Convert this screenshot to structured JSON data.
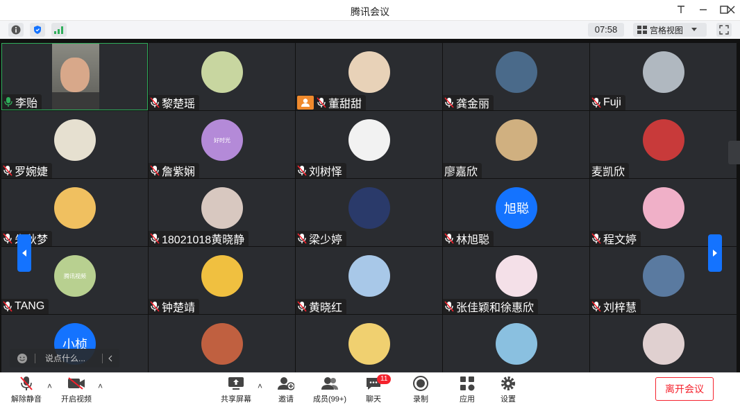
{
  "window": {
    "title": "腾讯会议"
  },
  "infobar": {
    "timer": "07:58",
    "view_label": "宫格视图"
  },
  "participants": [
    {
      "name": "李贻",
      "mic": "on",
      "video": true,
      "active": true
    },
    {
      "name": "黎楚瑶",
      "mic": "muted",
      "avatar": "avatar-1"
    },
    {
      "name": "董甜甜",
      "mic": "muted",
      "host": true,
      "avatar": "avatar-2"
    },
    {
      "name": "龚金丽",
      "mic": "muted",
      "avatar": "avatar-3"
    },
    {
      "name": "Fuji",
      "mic": "muted",
      "avatar": "avatar-4"
    },
    {
      "name": "罗婉婕",
      "mic": "muted",
      "avatar": "avatar-5"
    },
    {
      "name": "詹紫娴",
      "mic": "muted",
      "avatar": "avatar-6",
      "avatar_caption": "好时光"
    },
    {
      "name": "刘树怿",
      "mic": "muted",
      "avatar": "avatar-7"
    },
    {
      "name": "廖嘉欣",
      "mic": "none",
      "avatar": "avatar-8"
    },
    {
      "name": "麦凯欣",
      "mic": "none",
      "avatar": "avatar-9"
    },
    {
      "name": "朱秋梦",
      "mic": "muted",
      "avatar": "avatar-10"
    },
    {
      "name": "18021018黄晓静",
      "mic": "muted",
      "avatar": "avatar-11"
    },
    {
      "name": "梁少婷",
      "mic": "muted",
      "avatar": "avatar-12"
    },
    {
      "name": "林旭聪",
      "mic": "muted",
      "avatar_text": "旭聪"
    },
    {
      "name": "程文婷",
      "mic": "muted",
      "avatar": "avatar-14"
    },
    {
      "name": "TANG",
      "mic": "muted",
      "avatar": "avatar-15",
      "avatar_caption": "腾讯视频"
    },
    {
      "name": "钟楚靖",
      "mic": "muted",
      "avatar": "avatar-16"
    },
    {
      "name": "黄晓红",
      "mic": "muted",
      "avatar": "avatar-17"
    },
    {
      "name": "张佳颖和徐惠欣",
      "mic": "muted",
      "avatar": "avatar-18"
    },
    {
      "name": "刘梓慧",
      "mic": "muted",
      "avatar": "avatar-19"
    },
    {
      "name": "",
      "mic": "muted",
      "avatar_text": "小桢"
    },
    {
      "name": "",
      "mic": "muted",
      "avatar": "avatar-21"
    },
    {
      "name": "",
      "mic": "muted",
      "avatar": "avatar-22"
    },
    {
      "name": "",
      "mic": "muted",
      "avatar": "avatar-23"
    },
    {
      "name": "",
      "mic": "muted",
      "avatar": "avatar-24"
    }
  ],
  "chat_input": {
    "placeholder": "说点什么..."
  },
  "toolbar": {
    "unmute": "解除静音",
    "start_video": "开启视频",
    "share_screen": "共享屏幕",
    "invite": "邀请",
    "members": "成员(99+)",
    "chat": "聊天",
    "chat_badge": "11",
    "record": "录制",
    "apps": "应用",
    "settings": "设置",
    "leave": "离开会议"
  },
  "colors": {
    "accent": "#1473ff",
    "danger": "#f5222d",
    "host": "#f08a2d",
    "active_border": "#2fae5b"
  }
}
